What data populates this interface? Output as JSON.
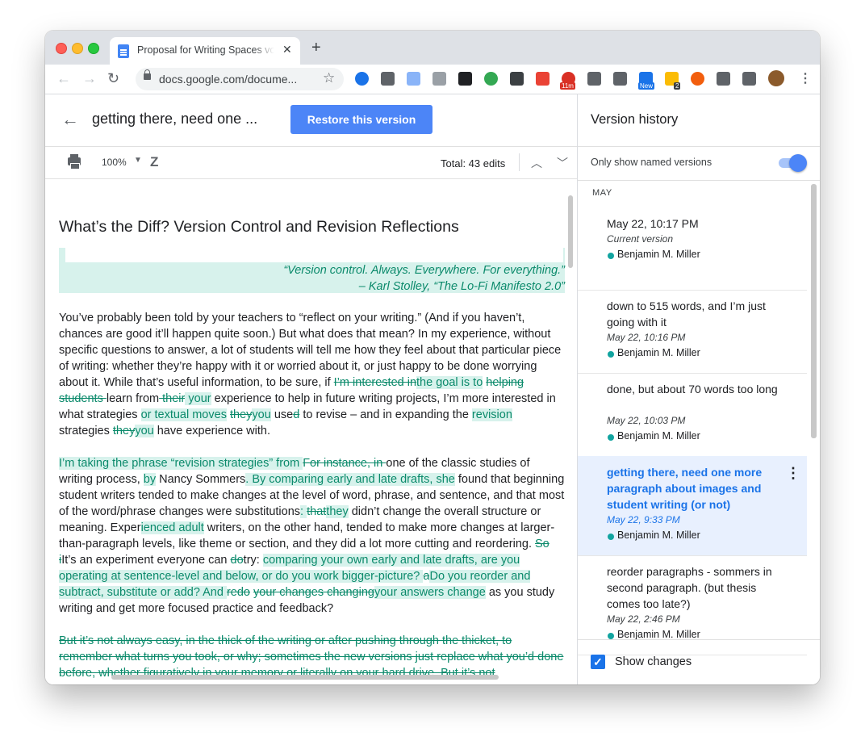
{
  "browser": {
    "tab_title": "Proposal for Writing Spaces vo",
    "url": "docs.google.com/docume...",
    "new_tab": "+",
    "close": "✕",
    "extensions": [
      {
        "name": "clock-icon",
        "color": "#1a73e8"
      },
      {
        "name": "h-icon",
        "color": "#5f6368"
      },
      {
        "name": "doc-icon",
        "color": "#8ab4f8"
      },
      {
        "name": "plus-doc-icon",
        "color": "#9aa0a6"
      },
      {
        "name": "y-icon",
        "color": "#202124"
      },
      {
        "name": "palette-icon",
        "color": "#34a853"
      },
      {
        "name": "camera-icon",
        "color": "#3c4043"
      },
      {
        "name": "rainbow-icon",
        "color": "#ea4335"
      },
      {
        "name": "timer-icon",
        "color": "#d93025"
      },
      {
        "name": "gear-icon",
        "color": "#5f6368"
      },
      {
        "name": "cloud-icon",
        "color": "#5f6368"
      },
      {
        "name": "new-icon",
        "color": "#1a73e8"
      },
      {
        "name": "star-badge-icon",
        "color": "#fbbc04"
      },
      {
        "name": "b-icon",
        "color": "#f25e0d"
      },
      {
        "name": "puzzle-icon",
        "color": "#5f6368"
      },
      {
        "name": "cast-icon",
        "color": "#5f6368"
      }
    ],
    "badges": {
      "timer": "11m",
      "new": "New",
      "count": "2"
    }
  },
  "doc": {
    "back": "←",
    "version_name": "getting there, need one ...",
    "restore_label": "Restore this version",
    "zoom": "100%",
    "total_edits": "Total: 43 edits",
    "heading": "What’s the Diff? Version Control and Revision Reflections",
    "quote_line1": "“Version control. Always. Everywhere. For everything.”",
    "quote_line2": "– Karl Stolley, “The Lo-Fi Manifesto 2.0”",
    "p1": [
      {
        "t": "You’ve probably been told by your teachers to “reflect on your writing.” (And if you haven’t, chances are good it’ll happen quite soon.) But what does that mean? In my experience, without specific questions to answer, a lot of students will tell me how they feel about that particular piece of writing: whether they’re happy with it or worried about it, or just happy to be done worrying about it. While that’s useful information, to be sure, if ",
        "s": "n"
      },
      {
        "t": "I’m interested in",
        "s": "d"
      },
      {
        "t": "the goal is to",
        "s": "i"
      },
      {
        "t": " ",
        "s": "n"
      },
      {
        "t": "helping students ",
        "s": "d"
      },
      {
        "t": "learn from",
        "s": "n"
      },
      {
        "t": " their",
        "s": "d"
      },
      {
        "t": " your",
        "s": "i"
      },
      {
        "t": " experience to help in future writing projects, I’m more interested in what strategies ",
        "s": "n"
      },
      {
        "t": "or textual moves",
        "s": "i"
      },
      {
        "t": " ",
        "s": "n"
      },
      {
        "t": "they",
        "s": "d"
      },
      {
        "t": "you",
        "s": "i"
      },
      {
        "t": " use",
        "s": "n"
      },
      {
        "t": "d",
        "s": "d"
      },
      {
        "t": " to revise – and in expanding the ",
        "s": "n"
      },
      {
        "t": "revision",
        "s": "i"
      },
      {
        "t": " strategies ",
        "s": "n"
      },
      {
        "t": "they",
        "s": "d"
      },
      {
        "t": "you",
        "s": "i"
      },
      {
        "t": " have experience with.",
        "s": "n"
      }
    ],
    "p2": [
      {
        "t": "I’m taking the phrase “revision strategies” from ",
        "s": "i"
      },
      {
        "t": "For instance, in ",
        "s": "d"
      },
      {
        "t": "one of the classic studies of writing process, ",
        "s": "n"
      },
      {
        "t": "by",
        "s": "i"
      },
      {
        "t": " Nancy Sommers",
        "s": "n"
      },
      {
        "t": ". By comparing early and late drafts, she",
        "s": "i"
      },
      {
        "t": " found that beginning student writers tended to make changes at the level of word, phrase, and sentence, and that most of the word/phrase changes were substitutions",
        "s": "n"
      },
      {
        "t": ": ",
        "s": "i"
      },
      {
        "t": "that",
        "s": "d"
      },
      {
        "t": "they",
        "s": "i"
      },
      {
        "t": " didn’t change the overall structure or meaning. Exper",
        "s": "n"
      },
      {
        "t": "ienced adult",
        "s": "i"
      },
      {
        "t": " writers, on the other hand, tended to make more changes at larger-than-paragraph levels, like theme or section, and they did a lot more cutting and reordering. ",
        "s": "n"
      },
      {
        "t": "So i",
        "s": "d"
      },
      {
        "t": "It’s an experiment everyone can ",
        "s": "n"
      },
      {
        "t": "do",
        "s": "d"
      },
      {
        "t": "try",
        "s": "n"
      },
      {
        "t": ": ",
        "s": "n"
      },
      {
        "t": "comparing your own early and late drafts, are you operating at sentence-level and below, or do you work bigger-picture? ",
        "s": "i"
      },
      {
        "t": "a",
        "s": "d"
      },
      {
        "t": "Do you reorder and subtract, substitute or add? And ",
        "s": "i"
      },
      {
        "t": "redo",
        "s": "d"
      },
      {
        "t": " ",
        "s": "n"
      },
      {
        "t": "your changes changing",
        "s": "d"
      },
      {
        "t": "your answers change",
        "s": "i"
      },
      {
        "t": " as you study writing and get more focused practice and feedback?",
        "s": "n"
      }
    ],
    "p3": [
      {
        "t": "But it’s not always easy, in the thick of the writing or after pushing through the thicket, to remember what turns you took, or why; sometimes the new versions just replace what you’d done before, whether figuratively in your memory or literally on your hard drive. But it’s not",
        "s": "d"
      }
    ]
  },
  "side": {
    "title": "Version history",
    "toggle_label": "Only show named versions",
    "month": "MAY",
    "versions": [
      {
        "title": "May 22, 10:17 PM",
        "time": "Current version",
        "author": "Benjamin M. Miller"
      },
      {
        "title": "down to 515 words, and I’m just going with it",
        "time": "May 22, 10:16 PM",
        "author": "Benjamin M. Miller"
      },
      {
        "title": "done, but about 70 words too long",
        "time": "May 22, 10:03 PM",
        "author": "Benjamin M. Miller"
      },
      {
        "title": "getting there, need one more paragraph about images and student writing (or not)",
        "time": "May 22, 9:33 PM",
        "author": "Benjamin M. Miller"
      },
      {
        "title": "reorder paragraphs - sommers in second paragraph. (but thesis comes too late?)",
        "time": "May 22, 2:46 PM",
        "author": "Benjamin M. Miller"
      }
    ],
    "show_changes": "Show changes",
    "checkmark": "✓"
  }
}
